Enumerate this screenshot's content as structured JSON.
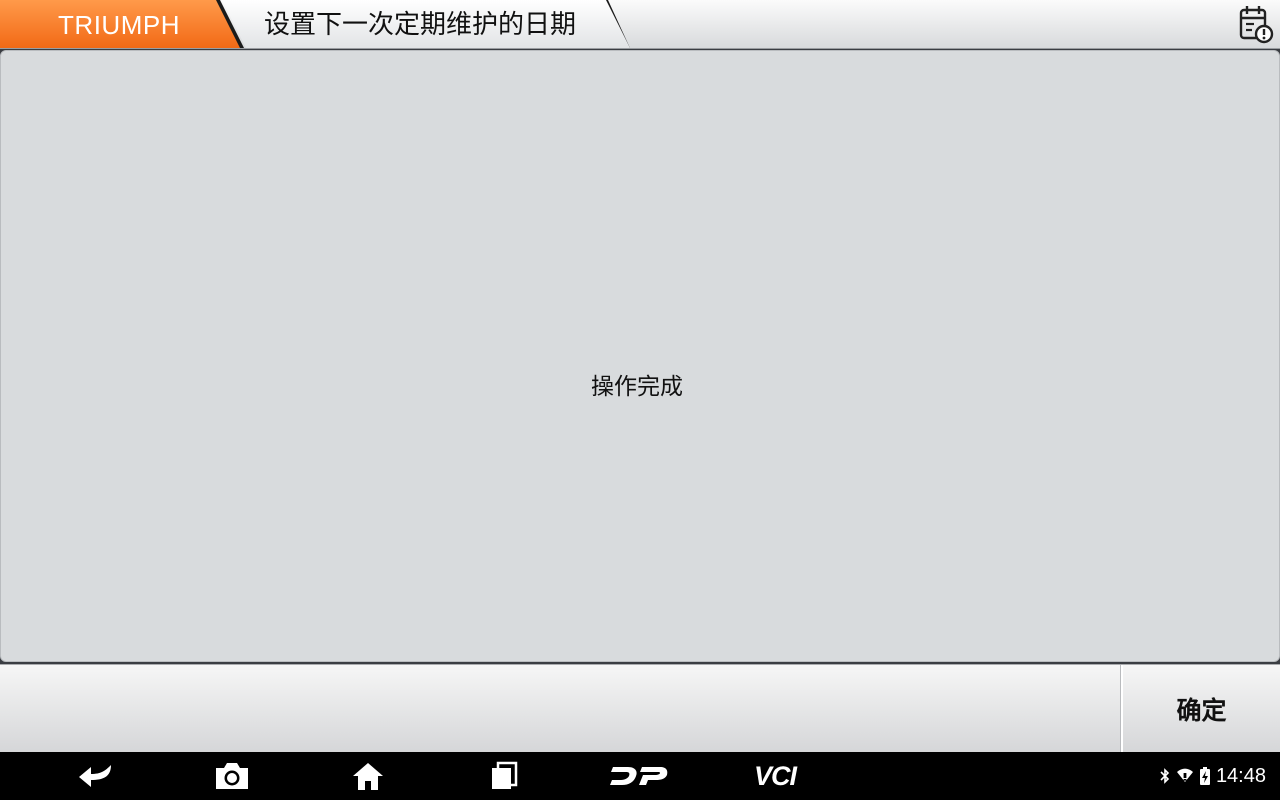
{
  "header": {
    "brand": "TRIUMPH",
    "title": "设置下一次定期维护的日期",
    "calendar_icon": "calendar-alert-icon"
  },
  "content": {
    "message": "操作完成"
  },
  "toolbar": {
    "confirm_label": "确定"
  },
  "navbar": {
    "icons": [
      "back-icon",
      "screenshot-icon",
      "home-icon",
      "recent-apps-icon",
      "dp-icon",
      "vci-icon"
    ],
    "vci_label": "VCI",
    "status_icons": [
      "bluetooth-icon",
      "wifi-icon",
      "battery-charging-icon"
    ],
    "time": "14:48"
  },
  "colors": {
    "accent": "#f26a16",
    "panel": "#d8dbdd",
    "navbar": "#000000"
  }
}
